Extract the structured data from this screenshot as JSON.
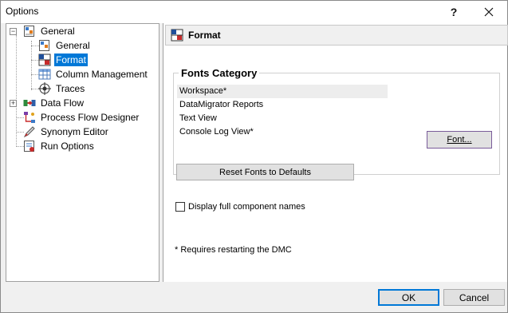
{
  "window": {
    "title": "Options",
    "help_label": "?",
    "close_label": "✕"
  },
  "tree": {
    "items": [
      {
        "label": "General"
      },
      {
        "label": "General"
      },
      {
        "label": "Format"
      },
      {
        "label": "Column Management"
      },
      {
        "label": "Traces"
      },
      {
        "label": "Data Flow"
      },
      {
        "label": "Process Flow Designer"
      },
      {
        "label": "Synonym Editor"
      },
      {
        "label": "Run Options"
      }
    ],
    "selected": "Format"
  },
  "panel": {
    "header": "Format",
    "fonts_category": {
      "title": "Fonts Category",
      "items": [
        "Workspace*",
        "DataMigrator Reports",
        "Text View",
        "Console Log View*"
      ],
      "selected": "Workspace*"
    },
    "font_button": "Font...",
    "reset_button": "Reset Fonts to Defaults",
    "checkbox_label": "Display full component names",
    "checkbox_checked": false,
    "note": "* Requires restarting the DMC"
  },
  "footer": {
    "ok": "OK",
    "cancel": "Cancel"
  },
  "colors": {
    "selection": "#0078d7",
    "window_bg": "#f0f0f0"
  }
}
